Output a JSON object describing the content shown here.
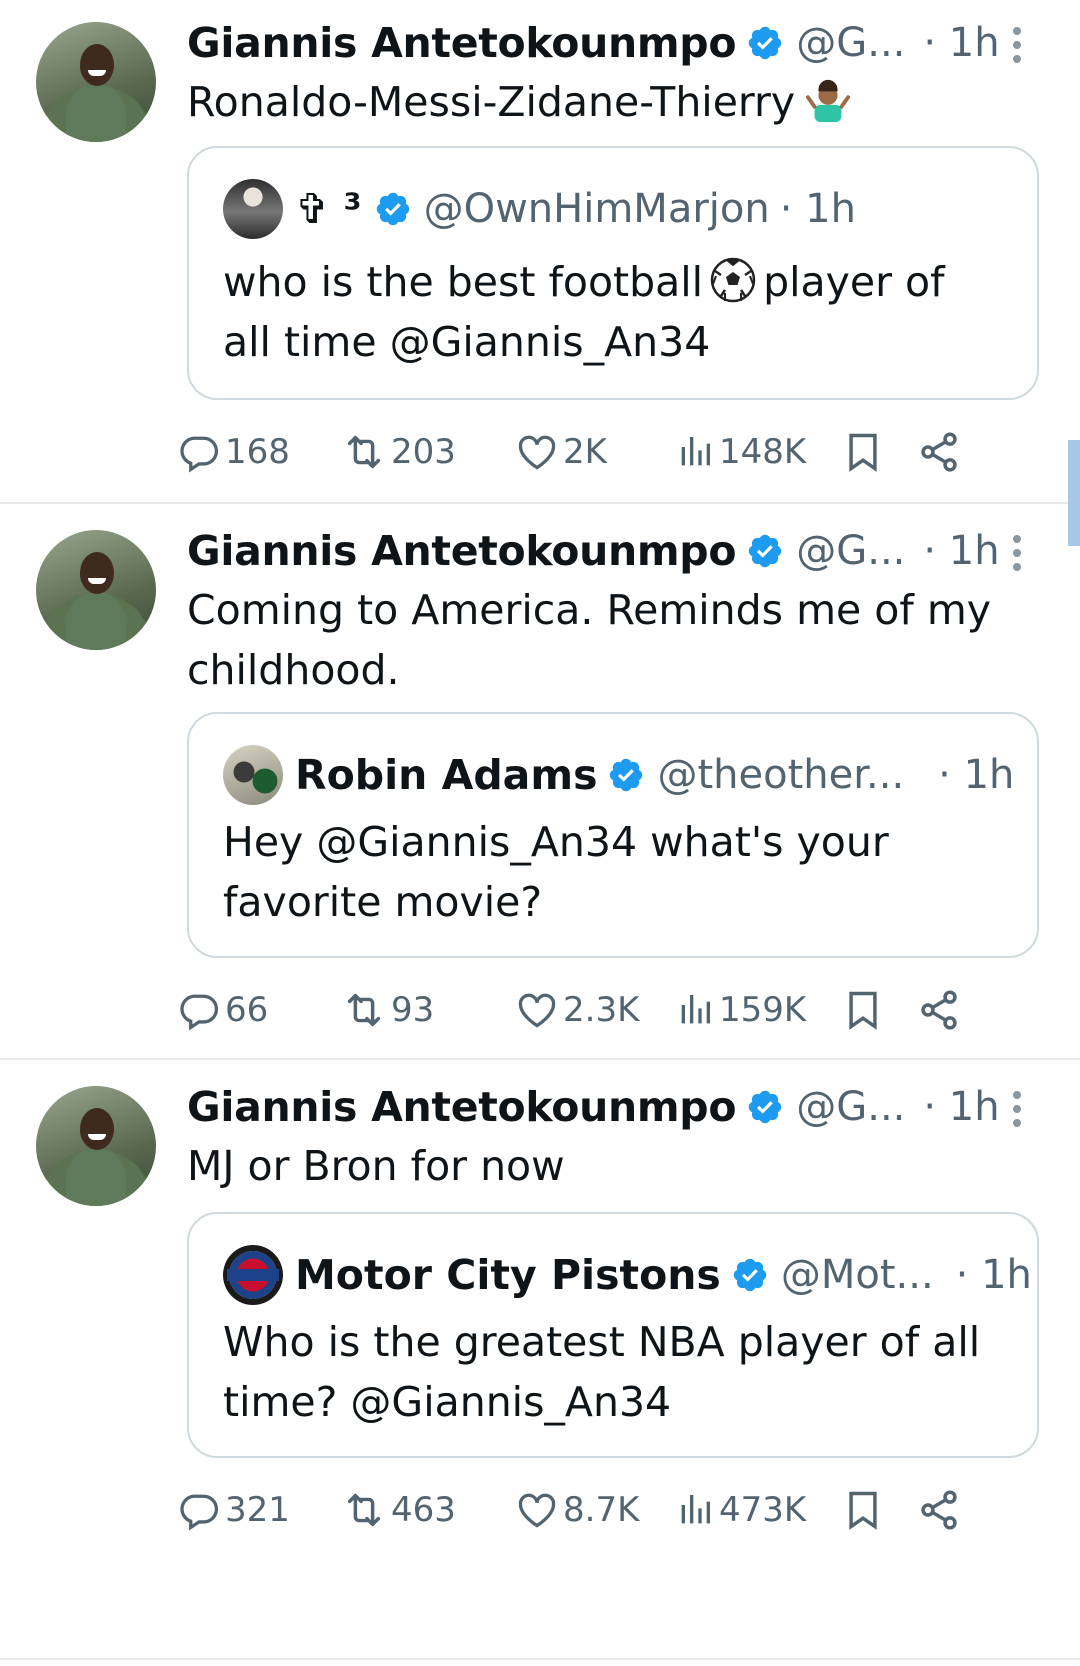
{
  "tweets": [
    {
      "author_name": "Giannis Antetokounmpo",
      "handle": "@G...",
      "time": "· 1h",
      "text": "Ronaldo-Messi-Zidane-Thierry",
      "text_emoji": "person-shrugging-emoji",
      "quote": {
        "author_name": "✞ ³",
        "handle": "@OwnHimMarjon",
        "time": "· 1h",
        "text_part1": "who is the best football",
        "text_emoji": "soccer-ball-emoji",
        "text_part2": "player of",
        "text_line2": "all time @Giannis_An34"
      },
      "stats": {
        "replies": "168",
        "reposts": "203",
        "likes": "2K",
        "views": "148K"
      }
    },
    {
      "author_name": "Giannis Antetokounmpo",
      "handle": "@G...",
      "time": "· 1h",
      "text_line1": "Coming to America. Reminds me of my",
      "text_line2": "childhood.",
      "quote": {
        "author_name": "Robin Adams",
        "handle": "@theother...",
        "time": "· 1h",
        "text_line1": "Hey @Giannis_An34 what's your",
        "text_line2": "favorite movie?"
      },
      "stats": {
        "replies": "66",
        "reposts": "93",
        "likes": "2.3K",
        "views": "159K"
      }
    },
    {
      "author_name": "Giannis Antetokounmpo",
      "handle": "@G...",
      "time": "· 1h",
      "text": "MJ or Bron for now",
      "quote": {
        "author_name": "Motor City Pistons",
        "handle": "@Mot...",
        "time": "· 1h",
        "text_line1": "Who is the greatest NBA player of all",
        "text_line2": "time? @Giannis_An34"
      },
      "stats": {
        "replies": "321",
        "reposts": "463",
        "likes": "8.7K",
        "views": "473K"
      }
    }
  ],
  "colors": {
    "verified": "#1d9bf0",
    "secondary_text": "#536471",
    "border": "#cfd9de",
    "divider": "#e6e9ec"
  }
}
